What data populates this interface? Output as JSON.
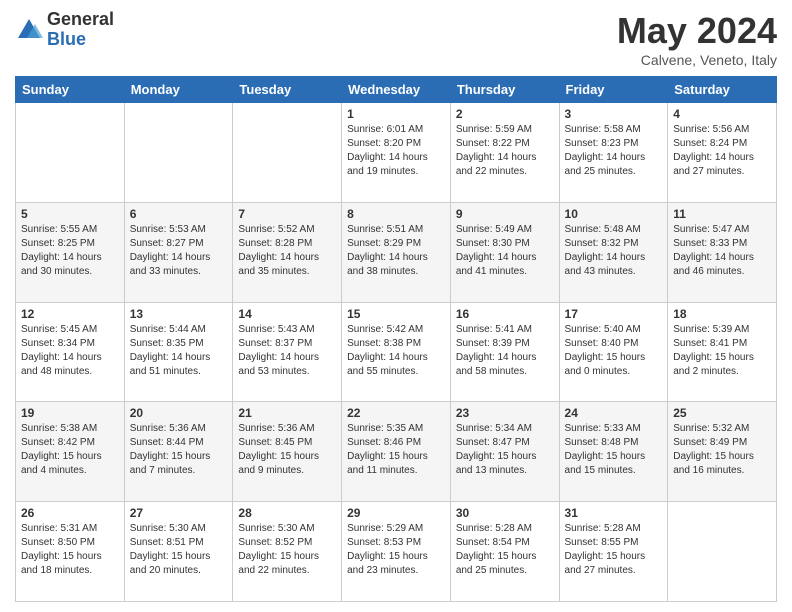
{
  "header": {
    "logo_general": "General",
    "logo_blue": "Blue",
    "month_title": "May 2024",
    "location": "Calvene, Veneto, Italy"
  },
  "weekdays": [
    "Sunday",
    "Monday",
    "Tuesday",
    "Wednesday",
    "Thursday",
    "Friday",
    "Saturday"
  ],
  "weeks": [
    [
      {
        "day": "",
        "info": ""
      },
      {
        "day": "",
        "info": ""
      },
      {
        "day": "",
        "info": ""
      },
      {
        "day": "1",
        "info": "Sunrise: 6:01 AM\nSunset: 8:20 PM\nDaylight: 14 hours\nand 19 minutes."
      },
      {
        "day": "2",
        "info": "Sunrise: 5:59 AM\nSunset: 8:22 PM\nDaylight: 14 hours\nand 22 minutes."
      },
      {
        "day": "3",
        "info": "Sunrise: 5:58 AM\nSunset: 8:23 PM\nDaylight: 14 hours\nand 25 minutes."
      },
      {
        "day": "4",
        "info": "Sunrise: 5:56 AM\nSunset: 8:24 PM\nDaylight: 14 hours\nand 27 minutes."
      }
    ],
    [
      {
        "day": "5",
        "info": "Sunrise: 5:55 AM\nSunset: 8:25 PM\nDaylight: 14 hours\nand 30 minutes."
      },
      {
        "day": "6",
        "info": "Sunrise: 5:53 AM\nSunset: 8:27 PM\nDaylight: 14 hours\nand 33 minutes."
      },
      {
        "day": "7",
        "info": "Sunrise: 5:52 AM\nSunset: 8:28 PM\nDaylight: 14 hours\nand 35 minutes."
      },
      {
        "day": "8",
        "info": "Sunrise: 5:51 AM\nSunset: 8:29 PM\nDaylight: 14 hours\nand 38 minutes."
      },
      {
        "day": "9",
        "info": "Sunrise: 5:49 AM\nSunset: 8:30 PM\nDaylight: 14 hours\nand 41 minutes."
      },
      {
        "day": "10",
        "info": "Sunrise: 5:48 AM\nSunset: 8:32 PM\nDaylight: 14 hours\nand 43 minutes."
      },
      {
        "day": "11",
        "info": "Sunrise: 5:47 AM\nSunset: 8:33 PM\nDaylight: 14 hours\nand 46 minutes."
      }
    ],
    [
      {
        "day": "12",
        "info": "Sunrise: 5:45 AM\nSunset: 8:34 PM\nDaylight: 14 hours\nand 48 minutes."
      },
      {
        "day": "13",
        "info": "Sunrise: 5:44 AM\nSunset: 8:35 PM\nDaylight: 14 hours\nand 51 minutes."
      },
      {
        "day": "14",
        "info": "Sunrise: 5:43 AM\nSunset: 8:37 PM\nDaylight: 14 hours\nand 53 minutes."
      },
      {
        "day": "15",
        "info": "Sunrise: 5:42 AM\nSunset: 8:38 PM\nDaylight: 14 hours\nand 55 minutes."
      },
      {
        "day": "16",
        "info": "Sunrise: 5:41 AM\nSunset: 8:39 PM\nDaylight: 14 hours\nand 58 minutes."
      },
      {
        "day": "17",
        "info": "Sunrise: 5:40 AM\nSunset: 8:40 PM\nDaylight: 15 hours\nand 0 minutes."
      },
      {
        "day": "18",
        "info": "Sunrise: 5:39 AM\nSunset: 8:41 PM\nDaylight: 15 hours\nand 2 minutes."
      }
    ],
    [
      {
        "day": "19",
        "info": "Sunrise: 5:38 AM\nSunset: 8:42 PM\nDaylight: 15 hours\nand 4 minutes."
      },
      {
        "day": "20",
        "info": "Sunrise: 5:36 AM\nSunset: 8:44 PM\nDaylight: 15 hours\nand 7 minutes."
      },
      {
        "day": "21",
        "info": "Sunrise: 5:36 AM\nSunset: 8:45 PM\nDaylight: 15 hours\nand 9 minutes."
      },
      {
        "day": "22",
        "info": "Sunrise: 5:35 AM\nSunset: 8:46 PM\nDaylight: 15 hours\nand 11 minutes."
      },
      {
        "day": "23",
        "info": "Sunrise: 5:34 AM\nSunset: 8:47 PM\nDaylight: 15 hours\nand 13 minutes."
      },
      {
        "day": "24",
        "info": "Sunrise: 5:33 AM\nSunset: 8:48 PM\nDaylight: 15 hours\nand 15 minutes."
      },
      {
        "day": "25",
        "info": "Sunrise: 5:32 AM\nSunset: 8:49 PM\nDaylight: 15 hours\nand 16 minutes."
      }
    ],
    [
      {
        "day": "26",
        "info": "Sunrise: 5:31 AM\nSunset: 8:50 PM\nDaylight: 15 hours\nand 18 minutes."
      },
      {
        "day": "27",
        "info": "Sunrise: 5:30 AM\nSunset: 8:51 PM\nDaylight: 15 hours\nand 20 minutes."
      },
      {
        "day": "28",
        "info": "Sunrise: 5:30 AM\nSunset: 8:52 PM\nDaylight: 15 hours\nand 22 minutes."
      },
      {
        "day": "29",
        "info": "Sunrise: 5:29 AM\nSunset: 8:53 PM\nDaylight: 15 hours\nand 23 minutes."
      },
      {
        "day": "30",
        "info": "Sunrise: 5:28 AM\nSunset: 8:54 PM\nDaylight: 15 hours\nand 25 minutes."
      },
      {
        "day": "31",
        "info": "Sunrise: 5:28 AM\nSunset: 8:55 PM\nDaylight: 15 hours\nand 27 minutes."
      },
      {
        "day": "",
        "info": ""
      }
    ]
  ]
}
